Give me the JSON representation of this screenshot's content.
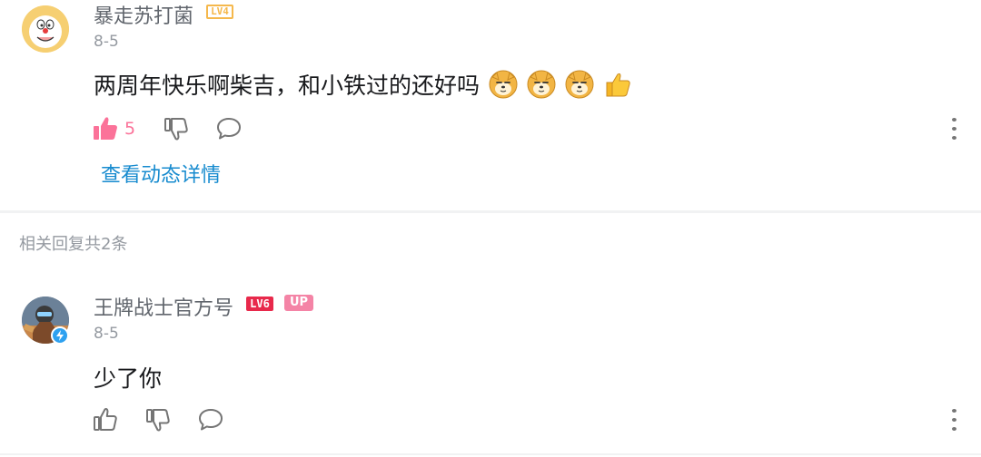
{
  "comment1": {
    "username": "暴走苏打菌",
    "level": "LV4",
    "date": "8-5",
    "text": "两周年快乐啊柴吉，和小铁过的还好吗",
    "emojis": [
      "doge-emoji",
      "doge-emoji",
      "doge-emoji",
      "thumbs-up-emoji"
    ],
    "like_count": "5",
    "view_detail_link": "查看动态详情",
    "liked": true
  },
  "replies_header": "相关回复共2条",
  "comment2": {
    "username": "王牌战士官方号",
    "level": "LV6",
    "badge": "UP",
    "date": "8-5",
    "text": "少了你",
    "liked": false
  },
  "colors": {
    "accent_pink": "#fb7299",
    "link_blue": "#178bcf",
    "level4": "#f5b84c",
    "level6": "#e8294b"
  }
}
